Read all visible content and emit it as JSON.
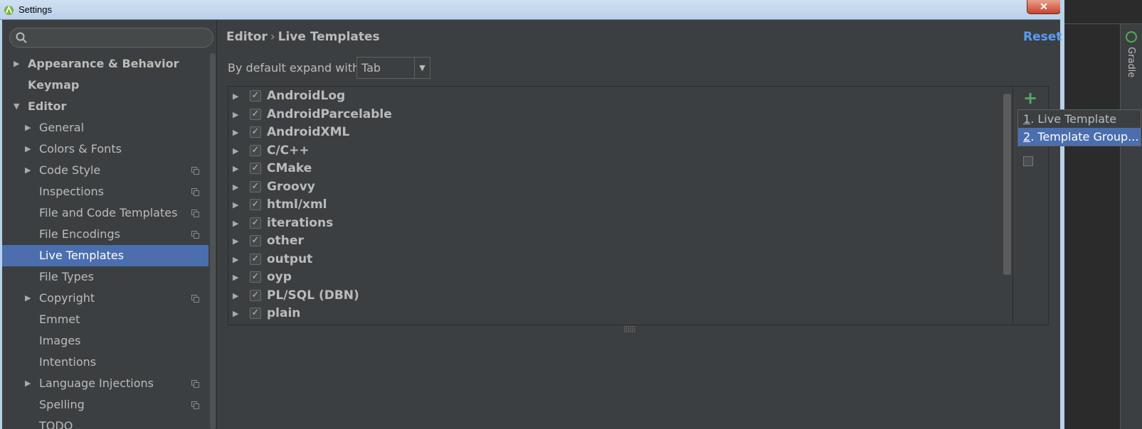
{
  "window": {
    "title": "Settings",
    "close_glyph": "✕"
  },
  "ide": {
    "gradle_label": "Gradle"
  },
  "search": {
    "placeholder": "",
    "value": ""
  },
  "sidebar": {
    "items": [
      {
        "label": "Appearance & Behavior",
        "bold": true,
        "arrow": "▶",
        "level": 0,
        "copy": false
      },
      {
        "label": "Keymap",
        "bold": true,
        "arrow": "",
        "level": 0,
        "copy": false
      },
      {
        "label": "Editor",
        "bold": true,
        "arrow": "▼",
        "level": 0,
        "copy": false
      },
      {
        "label": "General",
        "arrow": "▶",
        "level": 1,
        "copy": false
      },
      {
        "label": "Colors & Fonts",
        "arrow": "▶",
        "level": 1,
        "copy": false
      },
      {
        "label": "Code Style",
        "arrow": "▶",
        "level": 1,
        "copy": true
      },
      {
        "label": "Inspections",
        "arrow": "",
        "level": 1,
        "copy": true
      },
      {
        "label": "File and Code Templates",
        "arrow": "",
        "level": 1,
        "copy": true
      },
      {
        "label": "File Encodings",
        "arrow": "",
        "level": 1,
        "copy": true
      },
      {
        "label": "Live Templates",
        "arrow": "",
        "level": 1,
        "copy": false,
        "selected": true
      },
      {
        "label": "File Types",
        "arrow": "",
        "level": 1,
        "copy": false
      },
      {
        "label": "Copyright",
        "arrow": "▶",
        "level": 1,
        "copy": true
      },
      {
        "label": "Emmet",
        "arrow": "",
        "level": 1,
        "copy": false
      },
      {
        "label": "Images",
        "arrow": "",
        "level": 1,
        "copy": false
      },
      {
        "label": "Intentions",
        "arrow": "",
        "level": 1,
        "copy": false
      },
      {
        "label": "Language Injections",
        "arrow": "▶",
        "level": 1,
        "copy": true
      },
      {
        "label": "Spelling",
        "arrow": "",
        "level": 1,
        "copy": true
      },
      {
        "label": "TODO",
        "arrow": "",
        "level": 1,
        "copy": false
      }
    ]
  },
  "header": {
    "breadcrumb_parent": "Editor",
    "breadcrumb_separator": "›",
    "breadcrumb_current": "Live Templates",
    "reset_label": "Reset"
  },
  "expand": {
    "label": "By default expand with",
    "value": "Tab",
    "dropdown_glyph": "▼"
  },
  "templates": {
    "groups": [
      {
        "name": "AndroidLog",
        "checked": true
      },
      {
        "name": "AndroidParcelable",
        "checked": true
      },
      {
        "name": "AndroidXML",
        "checked": true
      },
      {
        "name": "C/C++",
        "checked": true
      },
      {
        "name": "CMake",
        "checked": true
      },
      {
        "name": "Groovy",
        "checked": true
      },
      {
        "name": "html/xml",
        "checked": true
      },
      {
        "name": "iterations",
        "checked": true
      },
      {
        "name": "other",
        "checked": true
      },
      {
        "name": "output",
        "checked": true
      },
      {
        "name": "oyp",
        "checked": true
      },
      {
        "name": "PL/SQL (DBN)",
        "checked": true
      },
      {
        "name": "plain",
        "checked": true
      }
    ],
    "add_glyph": "+",
    "splitter_glyph": "⣿⣿⣿"
  },
  "popup": {
    "items": [
      {
        "mnemonic": "1",
        "label": ". Live Template",
        "selected": false
      },
      {
        "mnemonic": "2",
        "label": ". Template Group...",
        "selected": true
      }
    ]
  },
  "colors": {
    "accent": "#4b6eaf",
    "link": "#589df6",
    "add": "#59a869",
    "background": "#3c3f41"
  }
}
